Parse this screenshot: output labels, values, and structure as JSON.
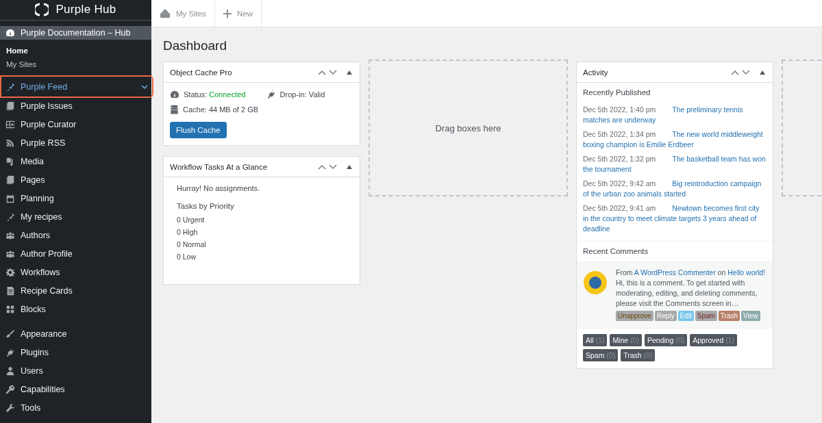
{
  "brand": {
    "name": "Purple Hub"
  },
  "top_bar": {
    "tabs": [
      {
        "label": "My Sites"
      },
      {
        "label": "New"
      }
    ]
  },
  "sidebar": {
    "site": "Purple Documentation – Hub",
    "submenu": [
      {
        "label": "Home",
        "selected": true
      },
      {
        "label": "My Sites",
        "selected": false
      }
    ],
    "groups": [
      [
        {
          "label": "Purple Feed",
          "selected": true
        },
        {
          "label": "Purple Issues",
          "selected": false
        },
        {
          "label": "Purple Curator",
          "selected": false
        },
        {
          "label": "Purple RSS",
          "selected": false
        },
        {
          "label": "Media",
          "selected": false
        },
        {
          "label": "Pages",
          "selected": false
        },
        {
          "label": "Planning",
          "selected": false
        },
        {
          "label": "My recipes",
          "selected": false
        },
        {
          "label": "Authors",
          "selected": false
        },
        {
          "label": "Author Profile",
          "selected": false
        },
        {
          "label": "Workflows",
          "selected": false
        },
        {
          "label": "Recipe Cards",
          "selected": false
        },
        {
          "label": "Blocks",
          "selected": false
        }
      ],
      [
        {
          "label": "Appearance",
          "selected": false
        },
        {
          "label": "Plugins",
          "selected": false
        },
        {
          "label": "Users",
          "selected": false
        },
        {
          "label": "Capabilities",
          "selected": false
        },
        {
          "label": "Tools",
          "selected": false
        }
      ]
    ]
  },
  "page_title": "Dashboard",
  "columns": [
    {
      "kind": "widgets",
      "widgets": [
        {
          "kind": "cache",
          "title": "Object Cache Pro",
          "status_label": "Status:",
          "status": "Connected",
          "dropin": "Drop-in: Valid",
          "cache": "Cache: 44 MB of 2 GB",
          "button": "Flush Cache"
        },
        {
          "kind": "tasks",
          "title": "Workflow Tasks At a Glance",
          "message": "Hurray! No assignments.",
          "subtitle": "Tasks by Priority",
          "priorities": [
            "0 Urgent",
            "0 High",
            "0 Normal",
            "0 Low"
          ]
        }
      ]
    },
    {
      "kind": "drop_zone",
      "text": "Drag boxes here"
    },
    {
      "kind": "widgets",
      "widgets": [
        {
          "kind": "activity",
          "title": "Activity",
          "published_title": "Recently Published",
          "posts": [
            {
              "date": "Dec 5th 2022, 1:40 pm",
              "title": "The preliminary tennis matches are underway"
            },
            {
              "date": "Dec 5th 2022, 1:34 pm",
              "title": "The new world middleweight boxing champion is Emilie Erdbeer"
            },
            {
              "date": "Dec 5th 2022, 1:32 pm",
              "title": "The basketball team has won the tournament"
            },
            {
              "date": "Dec 5th 2022, 9:42 am",
              "title": "Big reintroduction campaign of the urban zoo animals started"
            },
            {
              "date": "Dec 5th 2022, 9:41 am",
              "title": "Newtown becomes first city in the country to meet climate targets 3 years ahead of deadline"
            }
          ],
          "comments_title": "Recent Comments",
          "comment": {
            "from": "From",
            "author": "A WordPress Commenter",
            "on": "on",
            "post": "Hello world!",
            "text": "Hi, this is a comment. To get started with moderating, editing, and deleting comments, please visit the Comments screen in…",
            "actions": [
              {
                "label": "Unapprove",
                "kind": "warning",
                "color": "#a7a9ab"
              },
              {
                "label": "Reply",
                "kind": "plain",
                "color": "#a7a9ab"
              },
              {
                "label": "Edit",
                "kind": "plain",
                "color": "#79c6ea"
              },
              {
                "label": "Spam",
                "kind": "danger",
                "color": "#a7a9ab"
              },
              {
                "label": "Trash",
                "kind": "plain",
                "color": "#b88269"
              },
              {
                "label": "View",
                "kind": "plain",
                "color": "#8eabab"
              }
            ]
          },
          "filters": [
            {
              "label": "All",
              "count": "(1)"
            },
            {
              "label": "Mine",
              "count": "(0)"
            },
            {
              "label": "Pending",
              "count": "(0)"
            },
            {
              "label": "Approved",
              "count": "(1)"
            },
            {
              "label": "Spam",
              "count": "(0)"
            },
            {
              "label": "Trash",
              "count": "(0)"
            }
          ]
        }
      ]
    },
    {
      "kind": "drop_zone"
    }
  ]
}
